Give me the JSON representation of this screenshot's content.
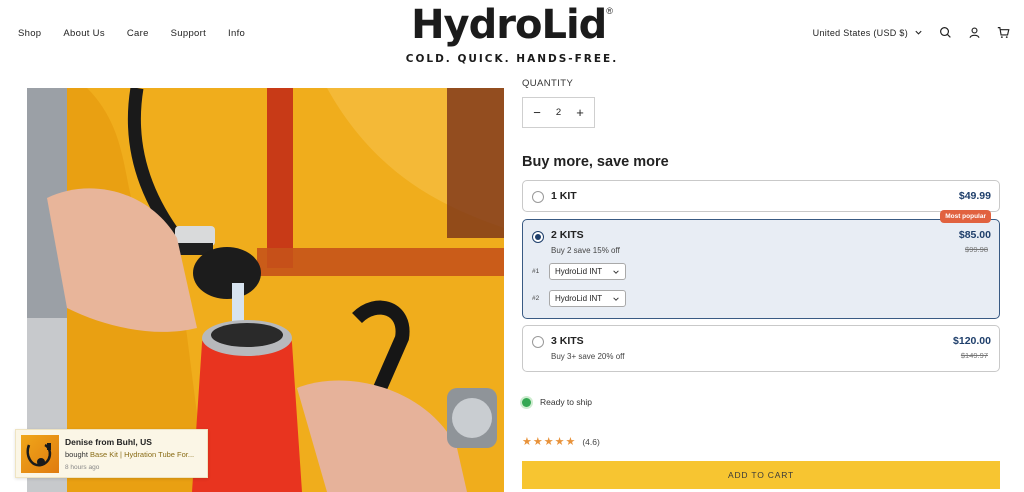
{
  "nav": {
    "items": [
      {
        "label": "Shop"
      },
      {
        "label": "About Us"
      },
      {
        "label": "Care"
      },
      {
        "label": "Support"
      },
      {
        "label": "Info"
      }
    ]
  },
  "brand": {
    "name": "HydroLid",
    "registered": "®",
    "tagline": "COLD. QUICK. HANDS-FREE."
  },
  "header": {
    "currency": "United States (USD $)",
    "icons": [
      "search-icon",
      "account-icon",
      "cart-icon"
    ]
  },
  "quantity": {
    "label": "QUANTITY",
    "value": "2",
    "minus": "−",
    "plus": "+"
  },
  "bundles": {
    "title": "Buy more, save more",
    "options": [
      {
        "title": "1 KIT",
        "price": "$49.99",
        "selected": false
      },
      {
        "title": "2 KITS",
        "subtitle": "Buy 2 save 15% off",
        "price": "$85.00",
        "compare_price": "$99.98",
        "badge": "Most popular",
        "selected": true,
        "variants": [
          {
            "num": "#1",
            "value": "HydroLid INT"
          },
          {
            "num": "#2",
            "value": "HydroLid INT"
          }
        ]
      },
      {
        "title": "3 KITS",
        "subtitle": "Buy 3+ save 20% off",
        "price": "$120.00",
        "compare_price": "$149.97",
        "selected": false
      }
    ]
  },
  "shipping": {
    "status": "Ready to ship",
    "color": "#34a853"
  },
  "rating": {
    "stars": "★★★★★",
    "value": "(4.6)",
    "score": 4.6,
    "color": "#e8923a"
  },
  "cart": {
    "label": "ADD TO CART",
    "color": "#f7c531"
  },
  "notification": {
    "name": "Denise from Buhl, US",
    "action": "bought",
    "product": "Base Kit | Hydration Tube For...",
    "time": "8 hours ago"
  },
  "colors": {
    "accent": "#1f3f6b",
    "badge": "#e1623f",
    "selected_bg": "#e8edf4"
  }
}
